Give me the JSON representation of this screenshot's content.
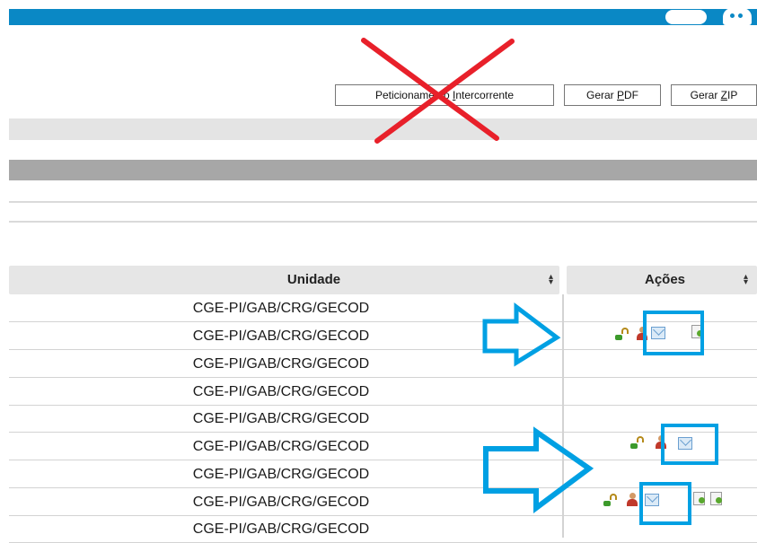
{
  "toolbar": {
    "buttons": [
      {
        "prefix": "Peticioname",
        "mid": "nto ",
        "ul": "I",
        "suffix": "ntercorrente"
      },
      {
        "prefix": "Gerar ",
        "ul": "P",
        "suffix": "DF"
      },
      {
        "prefix": "Gerar ",
        "ul": "Z",
        "suffix": "IP"
      }
    ]
  },
  "table": {
    "headers": {
      "unidade": "Unidade",
      "acoes": "Ações"
    },
    "rows": [
      {
        "unidade": "CGE-PI/GAB/CRG/GECOD",
        "actions": []
      },
      {
        "unidade": "CGE-PI/GAB/CRG/GECOD",
        "actions": [
          "lock-icon",
          "user-icon",
          "envelope-icon",
          "document-icon"
        ]
      },
      {
        "unidade": "CGE-PI/GAB/CRG/GECOD",
        "actions": []
      },
      {
        "unidade": "CGE-PI/GAB/CRG/GECOD",
        "actions": []
      },
      {
        "unidade": "CGE-PI/GAB/CRG/GECOD",
        "actions": []
      },
      {
        "unidade": "CGE-PI/GAB/CRG/GECOD",
        "actions": [
          "lock-icon",
          "user-icon",
          "envelope-icon"
        ]
      },
      {
        "unidade": "CGE-PI/GAB/CRG/GECOD",
        "actions": []
      },
      {
        "unidade": "CGE-PI/GAB/CRG/GECOD",
        "actions": [
          "lock-icon",
          "user-icon",
          "envelope-icon",
          "document-icon",
          "document-icon"
        ]
      },
      {
        "unidade": "CGE-PI/GAB/CRG/GECOD",
        "actions": []
      }
    ]
  },
  "annotation_colors": {
    "cross": "#e8202a",
    "highlight": "#00a0e3",
    "top_bar": "#0a88c5"
  }
}
